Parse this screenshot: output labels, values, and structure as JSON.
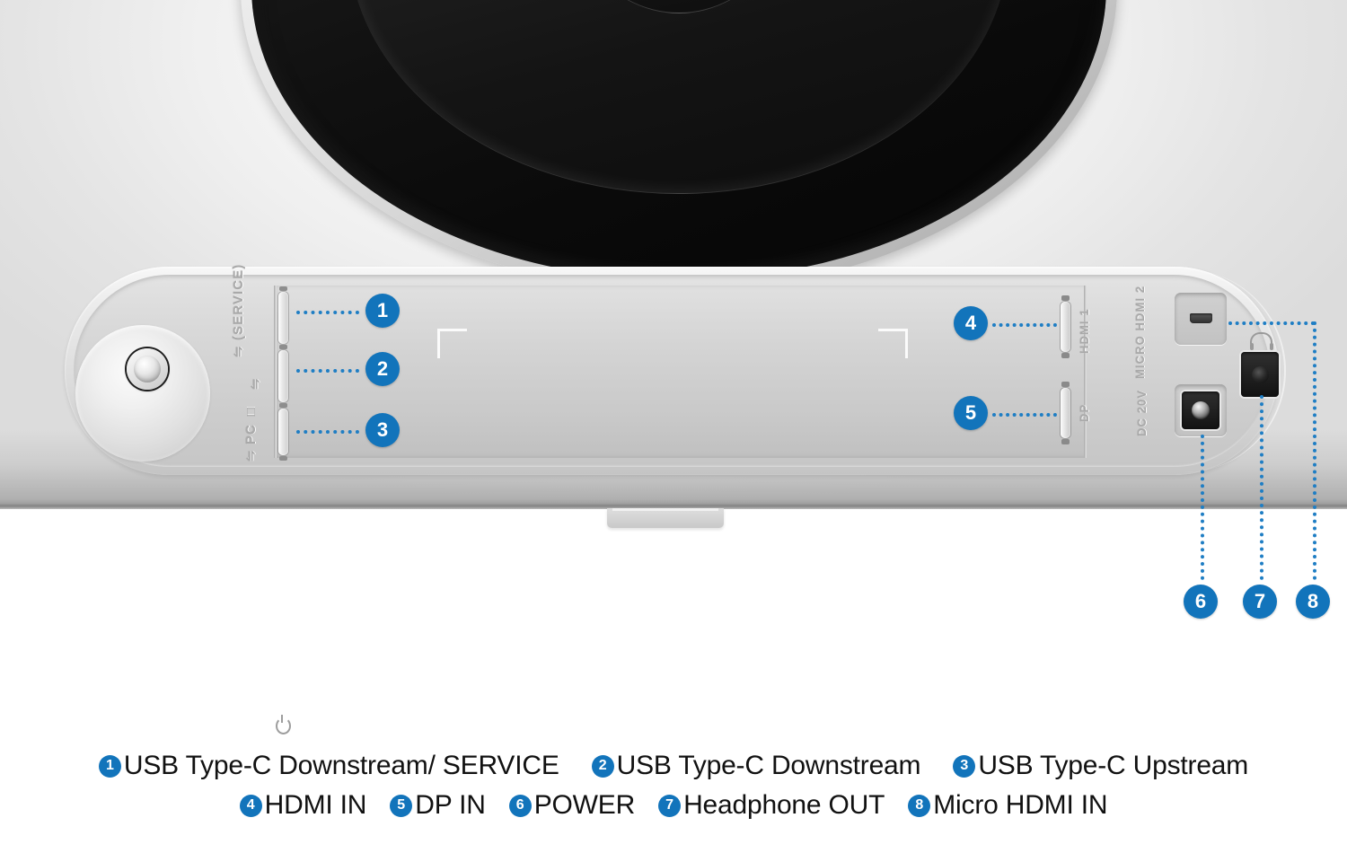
{
  "product": {
    "type": "monitor-rear-port-diagram",
    "accent_color": "#1274bb",
    "body_color": "#e8e8e8",
    "mount_color": "#101010"
  },
  "etched_labels": [
    {
      "id": "usb1",
      "text": "⇋ (SERVICE)"
    },
    {
      "id": "usb2",
      "text": "⇋"
    },
    {
      "id": "usb3",
      "text": "⇋ PC □"
    },
    {
      "id": "hdmi1",
      "text": "HDMI 1"
    },
    {
      "id": "dp",
      "text": "DP"
    },
    {
      "id": "microhdmi2",
      "text": "MICRO HDMI 2"
    },
    {
      "id": "dc",
      "text": "DC 20V"
    }
  ],
  "callouts": [
    {
      "number": "1",
      "target": "usb-type-c-downstream-service"
    },
    {
      "number": "2",
      "target": "usb-type-c-downstream"
    },
    {
      "number": "3",
      "target": "usb-type-c-upstream"
    },
    {
      "number": "4",
      "target": "hdmi-in"
    },
    {
      "number": "5",
      "target": "dp-in"
    },
    {
      "number": "6",
      "target": "power"
    },
    {
      "number": "7",
      "target": "headphone-out"
    },
    {
      "number": "8",
      "target": "micro-hdmi-in"
    }
  ],
  "legend": {
    "row1": [
      {
        "number": "1",
        "label": "USB Type-C Downstream/ SERVICE"
      },
      {
        "number": "2",
        "label": "USB Type-C Downstream"
      },
      {
        "number": "3",
        "label": "USB Type-C Upstream"
      }
    ],
    "row2": [
      {
        "number": "4",
        "label": "HDMI IN"
      },
      {
        "number": "5",
        "label": "DP IN"
      },
      {
        "number": "6",
        "label": "POWER"
      },
      {
        "number": "7",
        "label": "Headphone OUT"
      },
      {
        "number": "8",
        "label": "Micro HDMI IN"
      }
    ]
  }
}
